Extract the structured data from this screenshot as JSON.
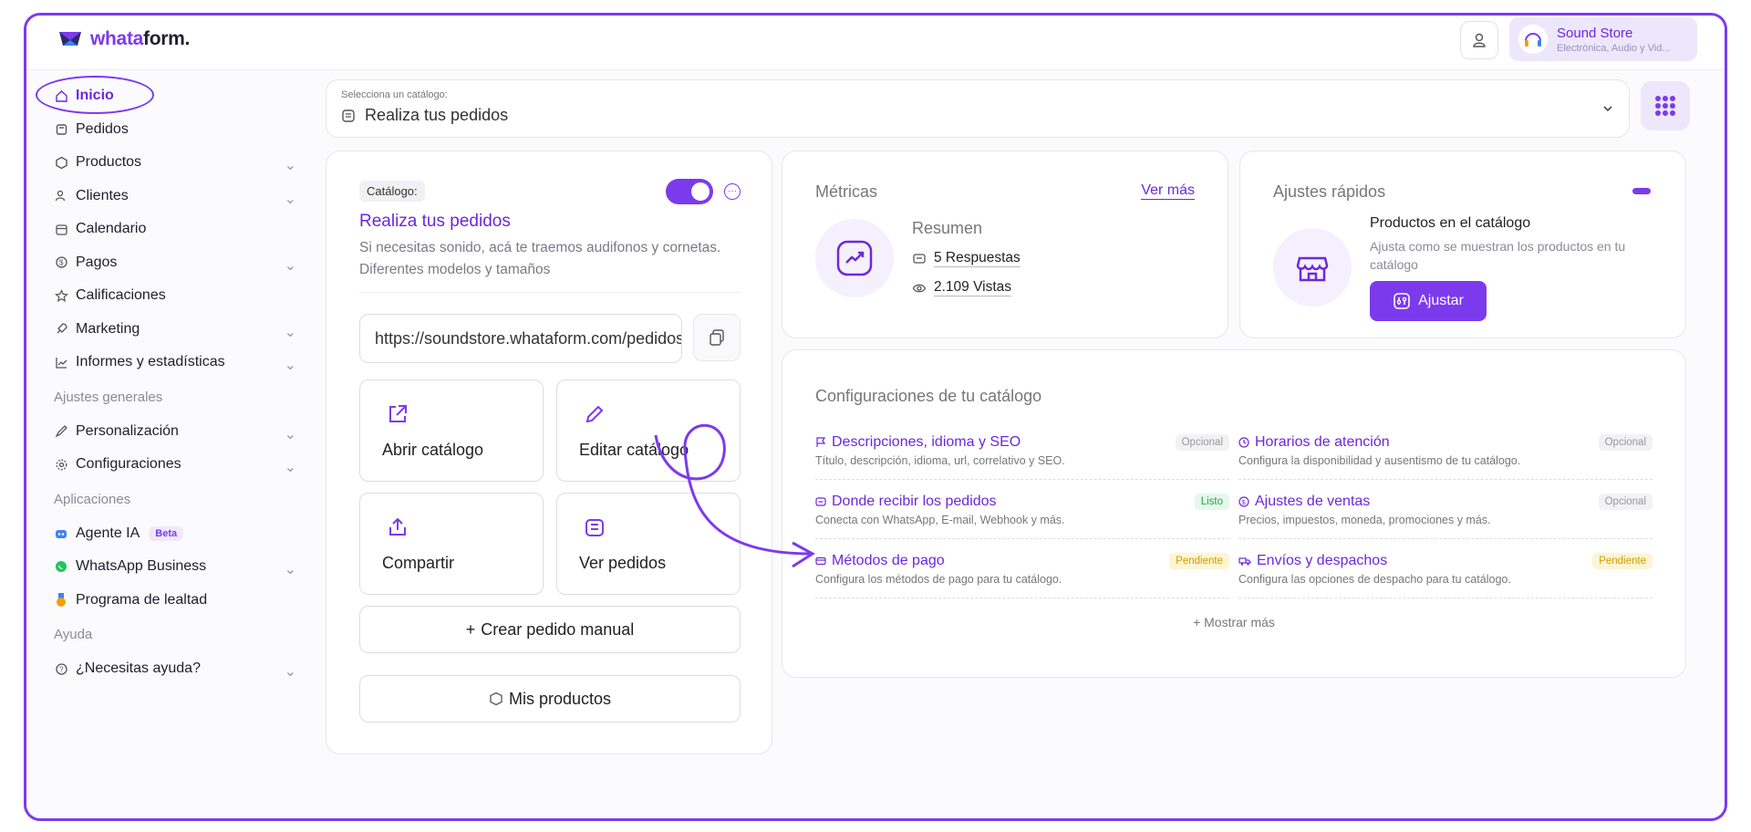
{
  "brand": {
    "logo_a": "whata",
    "logo_b": "form."
  },
  "store": {
    "name": "Sound Store",
    "subtitle": "Electrónica, Audio y Vid..."
  },
  "sidebar": {
    "items": [
      {
        "label": "Inicio"
      },
      {
        "label": "Pedidos"
      },
      {
        "label": "Productos"
      },
      {
        "label": "Clientes"
      },
      {
        "label": "Calendario"
      },
      {
        "label": "Pagos"
      },
      {
        "label": "Calificaciones"
      },
      {
        "label": "Marketing"
      },
      {
        "label": "Informes y estadísticas"
      }
    ],
    "section_general": "Ajustes generales",
    "general_items": [
      {
        "label": "Personalización"
      },
      {
        "label": "Configuraciones"
      }
    ],
    "section_apps": "Aplicaciones",
    "app_items": [
      {
        "label": "Agente IA",
        "badge": "Beta"
      },
      {
        "label": "WhatsApp Business"
      },
      {
        "label": "Programa de lealtad"
      }
    ],
    "section_help": "Ayuda",
    "help_items": [
      {
        "label": "¿Necesitas ayuda?"
      }
    ]
  },
  "selector": {
    "label": "Selecciona un catálogo:",
    "value": "Realiza tus pedidos"
  },
  "catalog": {
    "badge": "Catálogo:",
    "title": "Realiza tus pedidos",
    "description": "Si necesitas sonido, acá te traemos audifonos y cornetas. Diferentes modelos y tamaños",
    "url": "https://soundstore.whataform.com/pedidos",
    "tiles": [
      {
        "label": "Abrir catálogo"
      },
      {
        "label": "Editar catálogo"
      },
      {
        "label": "Compartir"
      },
      {
        "label": "Ver pedidos"
      }
    ],
    "create_order": "Crear pedido manual",
    "my_products": "Mis productos"
  },
  "metrics": {
    "title": "Métricas",
    "see_more": "Ver más",
    "summary": "Resumen",
    "responses": "5 Respuestas",
    "views": "2.109 Vistas"
  },
  "quick": {
    "title": "Ajustes rápidos",
    "item_title": "Productos en el catálogo",
    "item_desc": "Ajusta como se muestran los productos en tu catálogo",
    "button": "Ajustar"
  },
  "config": {
    "title": "Configuraciones de tu catálogo",
    "items": [
      {
        "title": "Descripciones, idioma y SEO",
        "desc": "Título, descripción, idioma, url, correlativo y SEO.",
        "status": "Opcional"
      },
      {
        "title": "Horarios de atención",
        "desc": "Configura la disponibilidad y ausentismo de tu catálogo.",
        "status": "Opcional"
      },
      {
        "title": "Donde recibir los pedidos",
        "desc": "Conecta con WhatsApp, E-mail, Webhook y más.",
        "status": "Listo"
      },
      {
        "title": "Ajustes de ventas",
        "desc": "Precios, impuestos, moneda, promociones y más.",
        "status": "Opcional"
      },
      {
        "title": "Métodos de pago",
        "desc": "Configura los métodos de pago para tu catálogo.",
        "status": "Pendiente"
      },
      {
        "title": "Envíos y despachos",
        "desc": "Configura las opciones de despacho para tu catálogo.",
        "status": "Pendiente"
      }
    ],
    "show_more": "Mostrar más"
  },
  "colors": {
    "accent": "#7c3aed",
    "ready": "#25a24b",
    "pending": "#d39a00"
  }
}
